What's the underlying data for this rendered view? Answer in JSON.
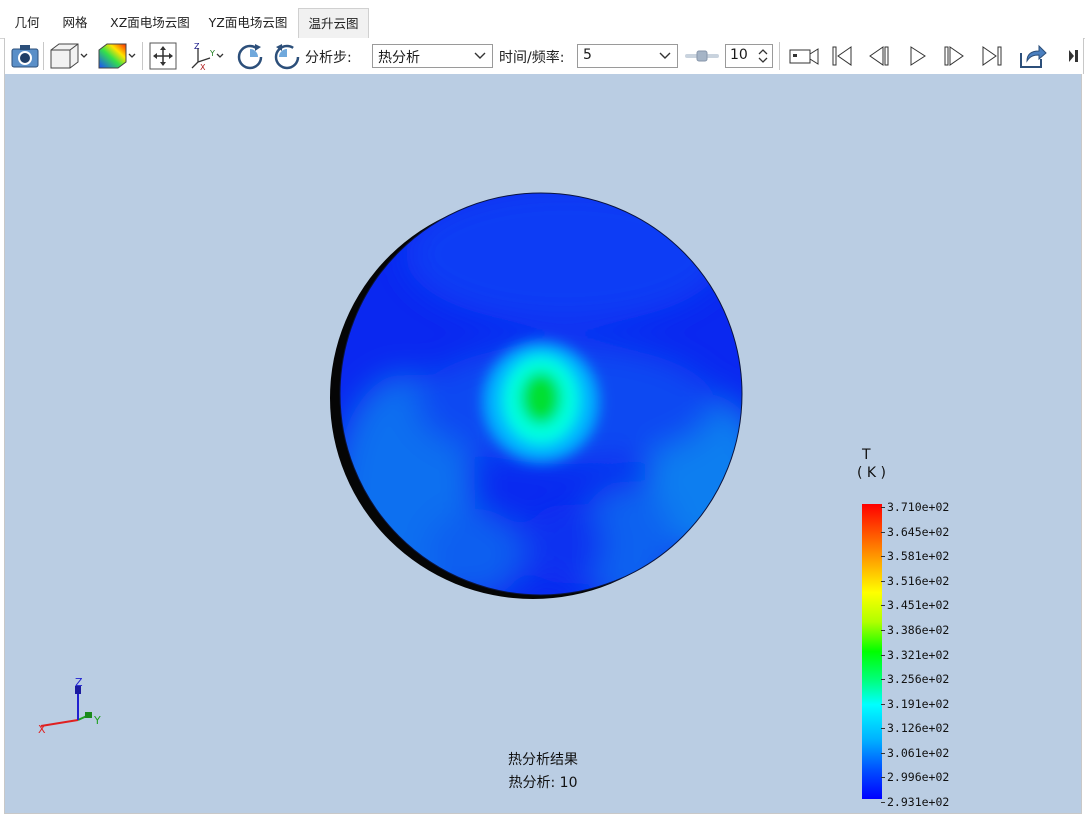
{
  "tabs": [
    "几何",
    "网格",
    "XZ面电场云图",
    "YZ面电场云图",
    "温升云图"
  ],
  "toolbar": {
    "step_label": "分析步:",
    "step_value": "热分析",
    "time_label": "时间/频率:",
    "time_value": "5",
    "spin_value": "10"
  },
  "legend": {
    "var": "T",
    "unit": "( K )",
    "ticks": [
      "3.710e+02",
      "3.645e+02",
      "3.581e+02",
      "3.516e+02",
      "3.451e+02",
      "3.386e+02",
      "3.321e+02",
      "3.256e+02",
      "3.191e+02",
      "3.126e+02",
      "3.061e+02",
      "2.996e+02",
      "2.931e+02"
    ]
  },
  "caption": {
    "line1": "热分析结果",
    "line2": "热分析: 10"
  },
  "axes": {
    "x": "X",
    "y": "Y",
    "z": "Z"
  },
  "colors": {
    "viewport_bg": "#bacde3",
    "field_cold": "#0000ff",
    "field_hot": "#ff0000"
  }
}
